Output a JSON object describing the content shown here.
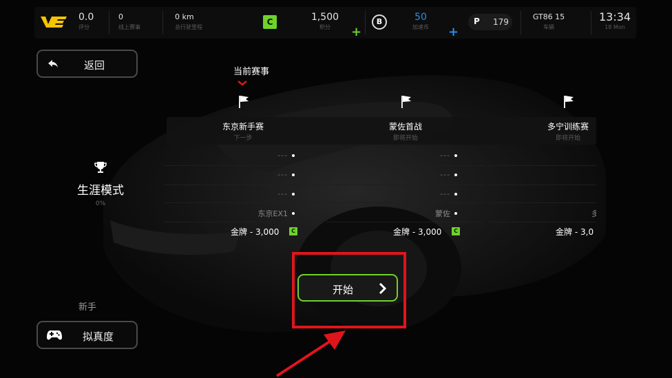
{
  "topbar": {
    "logo": "VE",
    "rating": {
      "value": "0.0",
      "label": "评分"
    },
    "online_races": {
      "value": "0",
      "label": "线上赛事"
    },
    "distance": {
      "value": "0 km",
      "label": "总行驶里程"
    },
    "license_badge": "C",
    "points": {
      "value": "1,500",
      "label": "积分"
    },
    "boost_badge": "B",
    "boost": {
      "value": "50",
      "label": "加速币"
    },
    "p_badge": "P",
    "p_value": "179",
    "vehicle": {
      "value": "GT86 15",
      "label": "车辆"
    },
    "clock": {
      "time": "13:34",
      "date": "18 Mon"
    },
    "plus_icon": "+",
    "colors": {
      "green": "#6fd22a",
      "blue": "#2a8fe8"
    }
  },
  "back_button": {
    "label": "返回",
    "icon": "back-arrow-icon"
  },
  "current_event_label": "当前赛事",
  "career": {
    "icon": "trophy-icon",
    "title": "生涯模式",
    "progress": "0%"
  },
  "difficulty": {
    "label": "新手",
    "button_label": "拟真度",
    "icon": "gamepad-icon"
  },
  "events": [
    {
      "name": "东京新手赛",
      "status": "下一步",
      "slots": [
        "---",
        "---",
        "---"
      ],
      "car": "东京EX1",
      "reward_label": "金牌",
      "reward_value": "3,000",
      "currency": "C"
    },
    {
      "name": "蒙佐首战",
      "status": "即将开始",
      "slots": [
        "---",
        "---",
        "---"
      ],
      "car": "蒙佐",
      "reward_label": "金牌",
      "reward_value": "3,000",
      "currency": "C"
    },
    {
      "name": "多宁训练赛",
      "status": "即将开始",
      "slots": [
        "---",
        "---",
        "---"
      ],
      "car": "多",
      "reward_label": "金牌",
      "reward_value": "3,0",
      "currency": "C"
    }
  ],
  "start_button": {
    "label": "开始",
    "icon": "chevron-right-icon"
  }
}
